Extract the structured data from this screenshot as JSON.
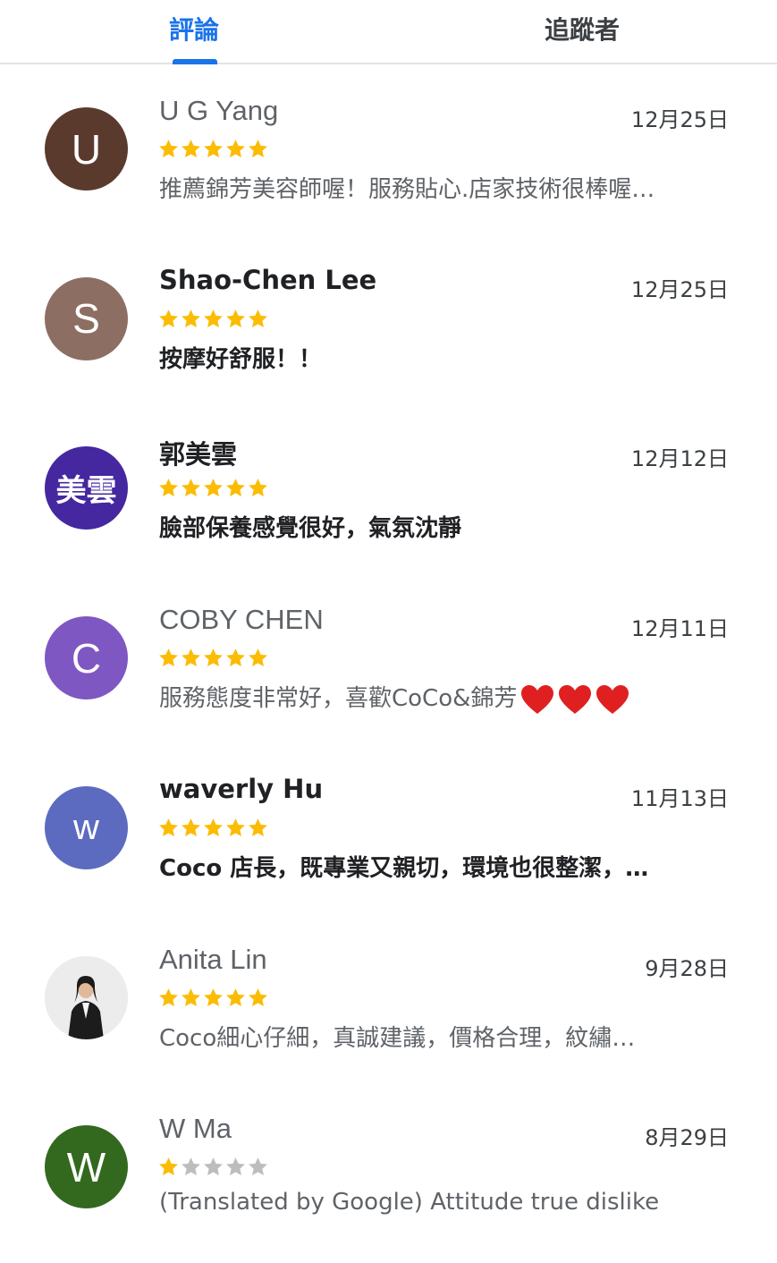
{
  "tabs": {
    "reviews": "評論",
    "followers": "追蹤者",
    "active": "reviews"
  },
  "colors": {
    "accent": "#1a73e8",
    "star_filled": "#fbbc04",
    "star_empty": "#bdbdbd",
    "heart": "#e02020"
  },
  "reviews": [
    {
      "avatar_letter": "U",
      "avatar_color": "#5b3a2e",
      "name": "U G Yang",
      "date": "12月25日",
      "rating": 5,
      "text": "推薦錦芳美容師喔！服務貼心.店家技術很棒喔…",
      "unread": false
    },
    {
      "avatar_letter": "S",
      "avatar_color": "#8d6e63",
      "name": "Shao-Chen Lee",
      "date": "12月25日",
      "rating": 5,
      "text": "按摩好舒服！！",
      "unread": true
    },
    {
      "avatar_letter": "美雲",
      "avatar_color": "#4527a0",
      "name": "郭美雲",
      "date": "12月12日",
      "rating": 5,
      "text": "臉部保養感覺很好，氣氛沈靜",
      "unread": true
    },
    {
      "avatar_letter": "C",
      "avatar_color": "#7e57c2",
      "name": "COBY CHEN",
      "date": "12月11日",
      "rating": 5,
      "text": "服務態度非常好，喜歡CoCo&錦芳",
      "hearts": 3,
      "unread": false
    },
    {
      "avatar_letter": "w",
      "avatar_color": "#5c6bc0",
      "name": "waverly Hu",
      "date": "11月13日",
      "rating": 5,
      "text": "Coco 店長，既專業又親切，環境也很整潔，…",
      "unread": true
    },
    {
      "avatar_letter": "",
      "avatar_color": "#e8e8e8",
      "avatar_photo": true,
      "name": "Anita Lin",
      "date": "9月28日",
      "rating": 5,
      "text": "Coco細心仔細，真誠建議，價格合理，紋繡…",
      "unread": false
    },
    {
      "avatar_letter": "W",
      "avatar_color": "#33691e",
      "name": "W Ma",
      "date": "8月29日",
      "rating": 1,
      "text": "(Translated by Google) Attitude true dislike",
      "unread": false
    }
  ]
}
